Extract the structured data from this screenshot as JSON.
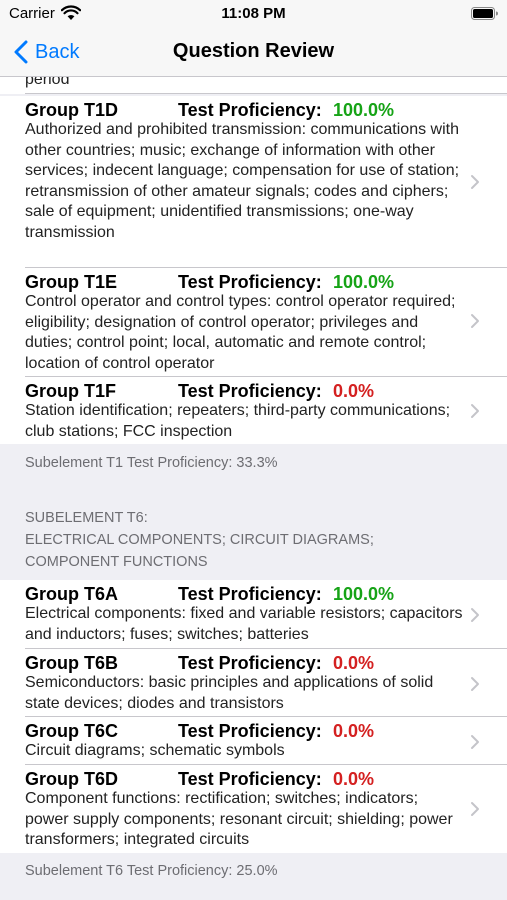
{
  "status_bar": {
    "carrier": "Carrier",
    "time": "11:08 PM"
  },
  "nav": {
    "back_label": "Back",
    "title": "Question Review"
  },
  "top_partial": "period",
  "proficiency_label": "Test Proficiency:",
  "groups": [
    {
      "name": "Group T1D",
      "value": "100.0%",
      "status": "pass",
      "desc": "Authorized and prohibited transmission: communications with other countries; music; exchange of information with other services; indecent language; compensation for use of station; retransmission of other amateur signals; codes and ciphers; sale of equipment; unidentified transmissions; one-way transmission"
    },
    {
      "name": "Group T1E",
      "value": "100.0%",
      "status": "pass",
      "desc": "Control operator and control types: control operator required; eligibility; designation of control operator; privileges and duties; control point; local, automatic and remote control; location of control operator"
    },
    {
      "name": "Group T1F",
      "value": "0.0%",
      "status": "fail",
      "desc": "Station identification; repeaters; third-party communications; club stations; FCC inspection"
    },
    {
      "name": "Group T6A",
      "value": "100.0%",
      "status": "pass",
      "desc": "Electrical components: fixed and variable resistors; capacitors and inductors; fuses; switches; batteries"
    },
    {
      "name": "Group T6B",
      "value": "0.0%",
      "status": "fail",
      "desc": "Semiconductors: basic principles and applications of solid state devices; diodes and transistors"
    },
    {
      "name": "Group T6C",
      "value": "0.0%",
      "status": "fail",
      "desc": "Circuit diagrams; schematic symbols"
    },
    {
      "name": "Group T6D",
      "value": "0.0%",
      "status": "fail",
      "desc": "Component functions: rectification; switches; indicators; power supply components; resonant circuit; shielding; power transformers; integrated circuits"
    }
  ],
  "t1_footer": "Subelement T1 Test Proficiency:  33.3%",
  "t6_header": [
    "SUBELEMENT T6:",
    "ELECTRICAL COMPONENTS; CIRCUIT DIAGRAMS;",
    "COMPONENT FUNCTIONS"
  ],
  "t6_footer": "Subelement T6 Test Proficiency:  25.0%",
  "colors": {
    "accent": "#007aff",
    "pass": "#16a316",
    "fail": "#d42020"
  }
}
